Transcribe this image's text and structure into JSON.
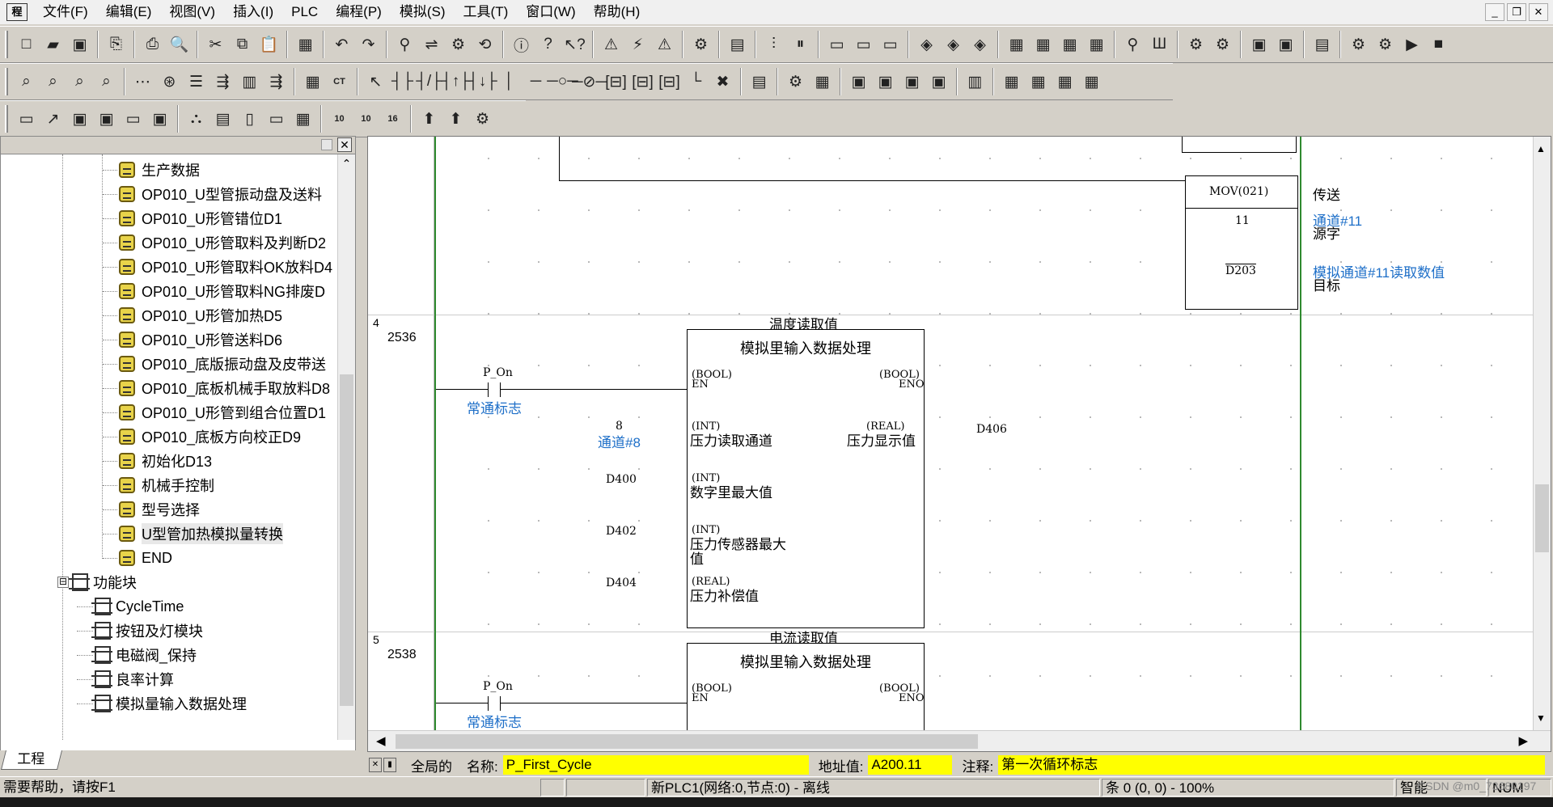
{
  "menu": {
    "app_icon": "程",
    "items": [
      "文件(F)",
      "编辑(E)",
      "视图(V)",
      "插入(I)",
      "PLC",
      "编程(P)",
      "模拟(S)",
      "工具(T)",
      "窗口(W)",
      "帮助(H)"
    ]
  },
  "window_controls": {
    "minimize": "_",
    "restore": "❐",
    "close": "✕"
  },
  "toolbar1": {
    "groups": [
      [
        "□",
        "▰",
        "▣"
      ],
      [
        "⎘"
      ],
      [
        "⎙",
        "🔍"
      ],
      [
        "✂",
        "⧉",
        "📋"
      ],
      [
        "▦"
      ],
      [
        "↶",
        "↷"
      ],
      [
        "⚲",
        "⇌",
        "⚙",
        "⟲"
      ],
      [
        "ⓘ",
        "?",
        "↖?"
      ],
      [
        "⚠",
        "⚡",
        "⚠"
      ],
      [
        "⚙"
      ],
      [
        "▤"
      ],
      [
        "⫶",
        "⏸"
      ],
      [
        "▭",
        "▭",
        "▭"
      ],
      [
        "◈",
        "◈",
        "◈"
      ],
      [
        "▦",
        "▦",
        "▦",
        "▦"
      ],
      [
        "⚲",
        "Ш"
      ],
      [
        "⚙",
        "⚙"
      ],
      [
        "▣",
        "▣"
      ],
      [
        "▤"
      ],
      [
        "⚙",
        "⚙",
        "▶",
        "■"
      ]
    ]
  },
  "toolbar2": {
    "groups": [
      [
        "⌕",
        "⌕",
        "⌕",
        "⌕"
      ],
      [
        "⋯",
        "⊛",
        "☰",
        "⇶",
        "▥",
        "⇶"
      ],
      [
        "▦",
        "CT"
      ],
      [
        "↖",
        "┤├",
        "┤/├",
        "┤↑├",
        "┤↓├",
        "│",
        "─",
        "─○─",
        "─⊘─",
        "[⊟]",
        "[⊟]",
        "[⊟]",
        "└",
        "✖"
      ],
      [
        "▤"
      ],
      [
        "⚙",
        "▦"
      ],
      [
        "▣",
        "▣",
        "▣",
        "▣"
      ],
      [
        "▥"
      ],
      [
        "▦",
        "▦",
        "▦",
        "▦"
      ]
    ]
  },
  "toolbar3": {
    "groups": [
      [
        "▭",
        "↗",
        "▣",
        "▣",
        "▭",
        "▣"
      ],
      [
        "⛬",
        "▤",
        "▯",
        "▭",
        "▦"
      ],
      [
        "10",
        "10",
        "16"
      ],
      [
        "⬆",
        "⬆",
        "⚙"
      ]
    ]
  },
  "tree": {
    "items": [
      {
        "label": "生产数据"
      },
      {
        "label": "OP010_U型管振动盘及送料"
      },
      {
        "label": "OP010_U形管错位D1"
      },
      {
        "label": "OP010_U形管取料及判断D2"
      },
      {
        "label": "OP010_U形管取料OK放料D4"
      },
      {
        "label": "OP010_U形管取料NG排废D"
      },
      {
        "label": "OP010_U形管加热D5"
      },
      {
        "label": "OP010_U形管送料D6"
      },
      {
        "label": "OP010_底版振动盘及皮带送"
      },
      {
        "label": "OP010_底板机械手取放料D8"
      },
      {
        "label": "OP010_U形管到组合位置D1"
      },
      {
        "label": "OP010_底板方向校正D9"
      },
      {
        "label": "初始化D13"
      },
      {
        "label": "机械手控制"
      },
      {
        "label": "型号选择"
      },
      {
        "label": "U型管加热模拟量转换"
      },
      {
        "label": "END"
      }
    ],
    "fb_folder": {
      "label": "功能块",
      "expander": "⊟"
    },
    "fb_items": [
      {
        "label": "CycleTime"
      },
      {
        "label": "按钮及灯模块"
      },
      {
        "label": "电磁阀_保持"
      },
      {
        "label": "良率计算"
      },
      {
        "label": "模拟量输入数据处理"
      }
    ],
    "tab_label": "工程",
    "close": "✕"
  },
  "ladder": {
    "mov": {
      "instr": "MOV(021)",
      "src_value": "11",
      "dst_value": "D203",
      "comment": "传送",
      "src_comment": "通道#11",
      "src_label": "源字",
      "dst_comment": "模拟通道#11读取数值",
      "dst_label": "目标"
    },
    "rung4": {
      "number": "4",
      "step": "2536",
      "caption": "温度读取值",
      "fb_title": "模拟里输入数据处理",
      "contact_label": "P_On",
      "contact_comment": "常通标志",
      "en_type": "(BOOL)",
      "en_name": "EN",
      "eno_type": "(BOOL)",
      "eno_name": "ENO",
      "in1_type": "(INT)",
      "in1_name": "压力读取通道",
      "in1_value": "8",
      "in1_comment": "通道#8",
      "out1_type": "(REAL)",
      "out1_name": "压力显示值",
      "out1_value": "D406",
      "in2_type": "(INT)",
      "in2_name": "数字里最大值",
      "in2_value": "D400",
      "in3_type": "(INT)",
      "in3_name": "压力传感器最大",
      "in3_name2": "值",
      "in3_value": "D402",
      "in4_type": "(REAL)",
      "in4_name": "压力补偿值",
      "in4_value": "D404"
    },
    "rung5": {
      "number": "5",
      "step": "2538",
      "caption": "电流读取值",
      "fb_title": "模拟里输入数据处理",
      "contact_label": "P_On",
      "contact_comment": "常通标志",
      "en_type": "(BOOL)",
      "en_name": "EN",
      "eno_type": "(BOOL)",
      "eno_name": "ENO"
    }
  },
  "infobar": {
    "scope": "全局的",
    "name_label": "名称:",
    "name_value": "P_First_Cycle",
    "addr_label": "地址值:",
    "addr_value": "A200.11",
    "comment_label": "注释:",
    "comment_value": "第一次循环标志"
  },
  "status": {
    "help": "需要帮助，请按F1",
    "plc": "新PLC1(网络:0,节点:0) - 离线",
    "position": "条 0 (0, 0) - 100%",
    "mode": "智能",
    "num": "NUM"
  },
  "watermark": "CSDN @m0_73680197"
}
